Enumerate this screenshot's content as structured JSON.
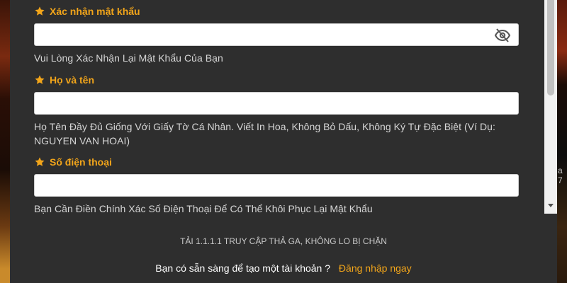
{
  "fields": [
    {
      "label": "Xác nhận mật khẩu",
      "value": "",
      "help": "Vui Lòng Xác Nhận Lại Mật Khẩu Của Bạn",
      "has_eye": true
    },
    {
      "label": "Họ và tên",
      "value": "",
      "help": "Họ Tên Đầy Đủ Giống Với Giấy Tờ Cá Nhân. Viết In Hoa, Không Bỏ Dấu, Không Ký Tự Đặc Biệt (Ví Dụ: NGUYEN VAN HOAI)"
    },
    {
      "label": "Số điện thoại",
      "value": "",
      "help": "Bạn Cần Điền Chính Xác Số Điện Thoại Để Có Thể Khôi Phục Lại Mật Khẩu"
    }
  ],
  "promo_text": "TẢI 1.1.1.1 TRUY CẬP THẢ GA, KHÔNG LO BỊ CHẶN",
  "login_prompt": "Bạn có sẵn sàng để tạo một tài khoản ?",
  "login_link": "Đăng nhập ngay",
  "background": {
    "right_edge_text": "a 7"
  },
  "icons": {
    "required_marker": "star-icon",
    "password_toggle": "eye-slash-icon",
    "scroll_down": "scroll-down-arrow-icon"
  },
  "colors": {
    "panel": "#2e2e2e",
    "accent": "#f2a51a",
    "help_text": "#d6d6d6",
    "input_bg": "#ffffff"
  }
}
